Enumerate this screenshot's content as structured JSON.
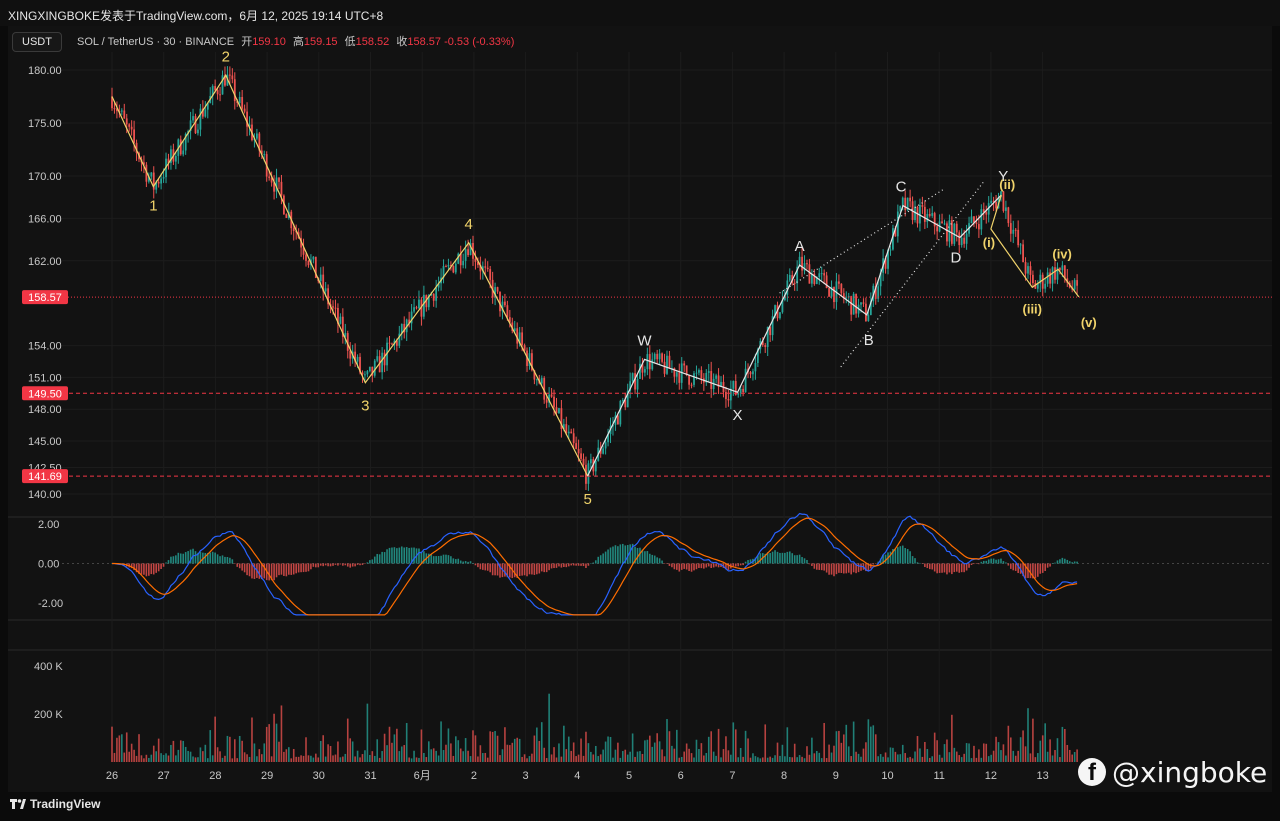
{
  "header": {
    "title": "XINGXINGBOKE发表于TradingView.com，6月 12, 2025 19:14 UTC+8"
  },
  "toolbar": {
    "currency_button": "USDT"
  },
  "legend": {
    "symbol": "SOL / TetherUS · 30 · BINANCE",
    "open_label": "开",
    "open": "159.10",
    "high_label": "高",
    "high": "159.15",
    "low_label": "低",
    "low": "158.52",
    "close_label": "收",
    "close": "158.57",
    "change": "-0.53 (-0.33%)"
  },
  "branding": {
    "logo_text": "TradingView",
    "watermark": "@xingboke"
  },
  "colors": {
    "up": "#26a69a",
    "down": "#ef5350",
    "wave": "#f0d36b",
    "wxy": "#e6e6e6",
    "price_tag": "#f23645",
    "macd": "#2962ff",
    "signal": "#ff6d00"
  },
  "chart_data": {
    "type": "line",
    "title": "SOL / TetherUS · 30 · BINANCE",
    "x_ticks": [
      "26",
      "27",
      "28",
      "29",
      "30",
      "31",
      "6月",
      "2",
      "3",
      "4",
      "5",
      "6",
      "7",
      "8",
      "9",
      "10",
      "11",
      "12",
      "13"
    ],
    "price_axis": {
      "ticks": [
        "180.00",
        "175.00",
        "170.00",
        "166.00",
        "162.00",
        "154.00",
        "151.00",
        "148.00",
        "145.00",
        "142.50",
        "140.00"
      ],
      "range": [
        139,
        181.5
      ]
    },
    "price_tags": [
      {
        "value": 158.57,
        "label": "158.57",
        "style": "dotted"
      },
      {
        "value": 149.5,
        "label": "149.50",
        "style": "dashed"
      },
      {
        "value": 141.69,
        "label": "141.69",
        "style": "dashed"
      }
    ],
    "series": [
      {
        "name": "",
        "x": [
          0.0,
          0.8,
          2.2,
          4.9,
          6.9,
          9.2,
          10.3,
          12.1,
          13.3,
          14.6,
          15.3,
          16.4,
          17.2,
          17.8,
          18.3,
          18.7
        ],
        "y": [
          177.5,
          169.0,
          179.5,
          150.5,
          163.7,
          141.7,
          152.7,
          149.6,
          161.6,
          156.9,
          167.2,
          164.2,
          168.2,
          159.5,
          161.2,
          158.6
        ]
      }
    ],
    "wave_labels": [
      {
        "text": "1",
        "x": 0.8,
        "y": 169.0,
        "group": "impulse"
      },
      {
        "text": "2",
        "x": 2.2,
        "y": 179.5,
        "group": "impulse"
      },
      {
        "text": "3",
        "x": 4.9,
        "y": 150.5,
        "group": "impulse"
      },
      {
        "text": "4",
        "x": 6.9,
        "y": 163.7,
        "group": "impulse"
      },
      {
        "text": "5",
        "x": 9.2,
        "y": 141.7,
        "group": "impulse"
      },
      {
        "text": "W",
        "x": 10.3,
        "y": 152.7,
        "group": "correction"
      },
      {
        "text": "X",
        "x": 12.1,
        "y": 149.6,
        "group": "correction"
      },
      {
        "text": "A",
        "x": 13.3,
        "y": 161.6,
        "group": "correction"
      },
      {
        "text": "B",
        "x": 14.6,
        "y": 156.9,
        "group": "correction"
      },
      {
        "text": "C",
        "x": 15.3,
        "y": 167.2,
        "group": "correction"
      },
      {
        "text": "D",
        "x": 16.4,
        "y": 164.2,
        "group": "correction"
      },
      {
        "text": "Y",
        "x": 17.2,
        "y": 168.2,
        "group": "correction"
      },
      {
        "text": "(i)",
        "x": 17.0,
        "y": 165.0,
        "group": "sub"
      },
      {
        "text": "(ii)",
        "x": 17.2,
        "y": 168.2,
        "group": "sub"
      },
      {
        "text": "(iii)",
        "x": 17.8,
        "y": 159.5,
        "group": "sub"
      },
      {
        "text": "(iv)",
        "x": 18.3,
        "y": 161.2,
        "group": "sub"
      },
      {
        "text": "(v)",
        "x": 18.7,
        "y": 158.6,
        "group": "sub"
      }
    ],
    "macd_axis": {
      "ticks": [
        "2.00",
        "0.00",
        "-2.00"
      ],
      "range": [
        -3.0,
        3.0
      ]
    },
    "volume_axis": {
      "ticks": [
        "400 K",
        "200 K"
      ],
      "range": [
        0,
        440000
      ]
    },
    "grid": true,
    "legend_position": "top-left"
  }
}
